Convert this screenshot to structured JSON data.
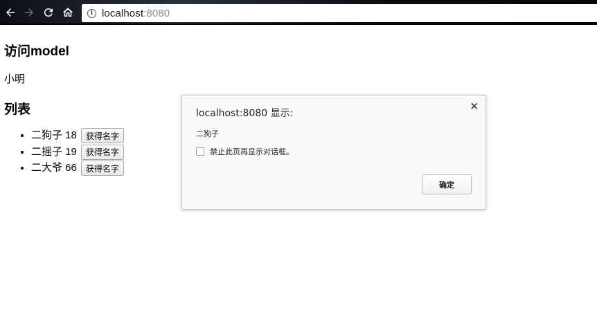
{
  "browser": {
    "url_host": "localhost",
    "url_port": ":8080",
    "icons": {
      "back": "arrow-left-icon",
      "forward": "arrow-right-icon",
      "reload": "reload-icon",
      "home": "home-icon",
      "info": "info-icon"
    },
    "info_glyph": "i"
  },
  "page": {
    "title": "访问model",
    "model_name": "小明",
    "list_title": "列表",
    "items": [
      {
        "label": "二狗子 18",
        "button": "获得名字"
      },
      {
        "label": "二摇子 19",
        "button": "获得名字"
      },
      {
        "label": "二大爷 66",
        "button": "获得名字"
      }
    ]
  },
  "dialog": {
    "title": "localhost:8080 显示:",
    "close": "×",
    "message": "二狗子",
    "suppress_label": "禁止此页再显示对话框。",
    "suppress_checked": false,
    "ok_label": "确定"
  }
}
